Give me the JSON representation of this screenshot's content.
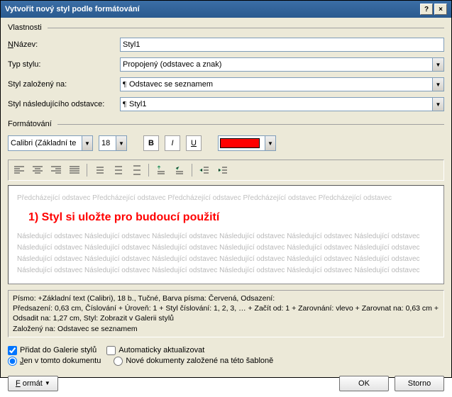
{
  "title": "Vytvořit nový styl podle formátování",
  "sections": {
    "props": "Vlastnosti",
    "format": "Formátování"
  },
  "labels": {
    "name": "Název:",
    "styleType": "Typ stylu:",
    "basedOn": "Styl založený na:",
    "nextPara": "Styl následujícího odstavce:"
  },
  "values": {
    "name": "Styl1",
    "styleType": "Propojený (odstavec a znak)",
    "basedOn": "Odstavec se seznamem",
    "nextPara": "Styl1",
    "font": "Calibri (Základní te",
    "size": "18",
    "color": "#ff0000"
  },
  "preview": {
    "before": "Předcházející odstavec Předcházející odstavec Předcházející odstavec Předcházející odstavec Předcházející odstavec",
    "sample": "1) Styl si uložte pro budoucí použití",
    "after": "Následující odstavec Následující odstavec Následující odstavec Následující odstavec Následující odstavec Následující odstavec"
  },
  "descLines": [
    "Písmo: +Základní text (Calibri), 18 b., Tučné, Barva písma: Červená, Odsazení:",
    "    Předsazení:  0,63 cm, Číslování + Úroveň: 1 + Styl číslování: 1, 2, 3, … + Začít od: 1 + Zarovnání: vlevo + Zarovnat na:  0,63 cm + Odsadit na:  1,27 cm, Styl: Zobrazit v Galerii stylů",
    "    Založený na: Odstavec se seznamem"
  ],
  "checks": {
    "addGallery": "Přidat do Galerie stylů",
    "autoUpdate": "Automaticky aktualizovat"
  },
  "radios": {
    "thisDoc": "Jen v tomto dokumentu",
    "newDocs": "Nové dokumenty založené na této šabloně"
  },
  "buttons": {
    "format": "Formát",
    "ok": "OK",
    "cancel": "Storno"
  }
}
